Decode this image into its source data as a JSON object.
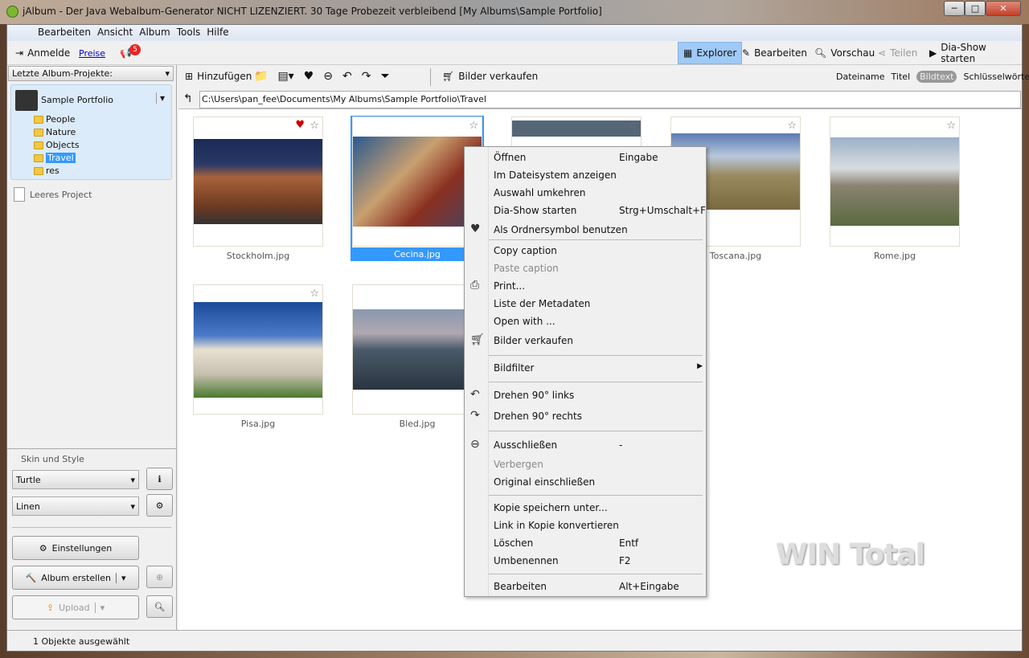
{
  "window": {
    "title": "jAlbum - Der Java Webalbum-Generator NICHT LIZENZIERT. 30 Tage Probezeit verbleibend [My Albums\\Sample Portfolio]",
    "min": "─",
    "max": "□",
    "close": "✕"
  },
  "menu": [
    "Bearbeiten",
    "Ansicht",
    "Album",
    "Tools",
    "Hilfe"
  ],
  "toolbar": {
    "login": "Anmelde",
    "prices": "Preise",
    "badge": "5"
  },
  "views": [
    "Explorer",
    "Bearbeiten",
    "Vorschau",
    "Teilen",
    "Dia-Show starten"
  ],
  "left": {
    "recent_label": "Letzte Album-Projekte:",
    "project": "Sample Portfolio",
    "folders": [
      "People",
      "Nature",
      "Objects",
      "Travel",
      "res"
    ],
    "empty_project": "Leeres Project",
    "skin_group": "Skin und Style",
    "skin": "Turtle",
    "style": "Linen",
    "settings": "Einstellungen",
    "make_album": "Album erstellen",
    "upload": "Upload"
  },
  "actions": {
    "add": "Hinzufügen",
    "sell": "Bilder verkaufen"
  },
  "label_modes": [
    "Dateiname",
    "Titel",
    "Bildtext",
    "Schlüsselwörter"
  ],
  "path": "C:\\Users\\pan_fee\\Documents\\My Albums\\Sample Portfolio\\Travel",
  "images": [
    {
      "name": "Stockholm.jpg",
      "fav": true
    },
    {
      "name": "Cecina.jpg",
      "selected": true
    },
    {
      "name": ""
    },
    {
      "name": "Toscana.jpg"
    },
    {
      "name": "Rome.jpg"
    },
    {
      "name": "Pisa.jpg"
    },
    {
      "name": "Bled.jpg"
    }
  ],
  "context_menu": [
    {
      "label": "Öffnen",
      "key": "Eingabe"
    },
    {
      "label": "Im Dateisystem anzeigen"
    },
    {
      "label": "Auswahl umkehren"
    },
    {
      "label": "Dia-Show starten",
      "key": "Strg+Umschalt+F"
    },
    {
      "label": "Als Ordnersymbol benutzen"
    },
    {
      "label": "Copy caption"
    },
    {
      "label": "Paste caption"
    },
    {
      "label": "Print..."
    },
    {
      "label": "Liste der Metadaten"
    },
    {
      "label": "Open with ..."
    },
    {
      "label": "Bilder verkaufen"
    },
    {
      "label": "Bildfilter"
    },
    {
      "label": "Drehen 90° links"
    },
    {
      "label": "Drehen 90° rechts"
    },
    {
      "label": "Ausschließen",
      "key": "-"
    },
    {
      "label": "Verbergen"
    },
    {
      "label": "Original einschließen"
    },
    {
      "label": "Kopie speichern unter..."
    },
    {
      "label": "Link in Kopie konvertieren"
    },
    {
      "label": "Löschen",
      "key": "Entf"
    },
    {
      "label": "Umbenennen",
      "key": "F2"
    },
    {
      "label": "Bearbeiten",
      "key": "Alt+Eingabe"
    }
  ],
  "status": "1 Objekte ausgewählt",
  "watermark": "WIN Total"
}
